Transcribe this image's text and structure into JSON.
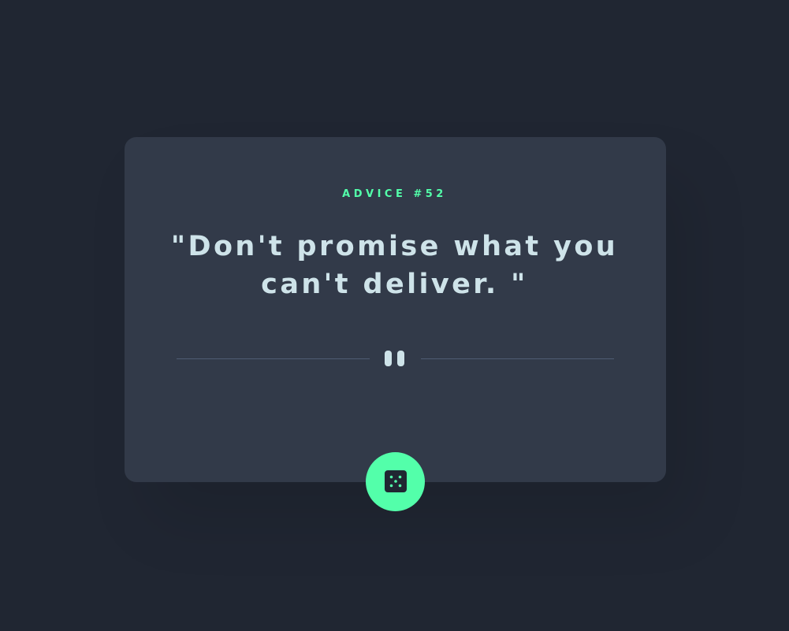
{
  "advice": {
    "number_label": "ADVICE #52",
    "quote": "\"Don't promise what you can't deliver. \""
  },
  "divider": {
    "icon": "pause-icon"
  },
  "button": {
    "icon": "dice-icon",
    "accent_color": "#53ffaa"
  },
  "colors": {
    "background": "#202632",
    "card": "#323a49",
    "accent": "#53ffaa",
    "quote_text": "#cee3e9",
    "divider_line": "#4f5d74"
  }
}
